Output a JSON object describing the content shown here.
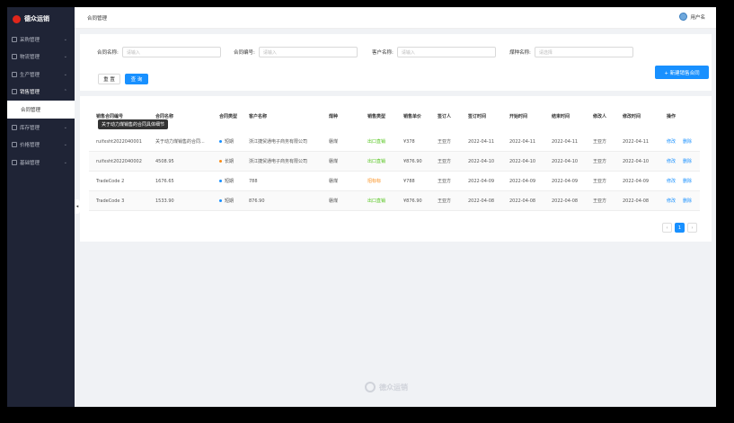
{
  "brand": {
    "name": "德众运销"
  },
  "sidebar": {
    "items": [
      {
        "label": "采购管理",
        "chev": "⌄"
      },
      {
        "label": "物流管理",
        "chev": "⌄"
      },
      {
        "label": "生产管理",
        "chev": "⌄"
      },
      {
        "label": "销售管理",
        "chev": "⌃"
      },
      {
        "label": "库存管理",
        "chev": "⌄"
      },
      {
        "label": "价格管理",
        "chev": "⌄"
      },
      {
        "label": "基础管理",
        "chev": "⌄"
      }
    ],
    "submenu_label": "合同管理"
  },
  "topbar": {
    "breadcrumb": "合同管理",
    "user": "用户名"
  },
  "filters": {
    "contract_name_label": "合同名称:",
    "contract_name_placeholder": "请输入",
    "contract_no_label": "合同编号:",
    "contract_no_placeholder": "请输入",
    "customer_label": "客户名称:",
    "customer_placeholder": "请输入",
    "coal_label": "煤种名称:",
    "coal_placeholder": "请选择",
    "reset": "重 置",
    "query": "查 询",
    "new": "+ 新建销售合同"
  },
  "table": {
    "headers": [
      "销售合同编号",
      "合同名称",
      "合同类型",
      "客户名称",
      "煤种",
      "销售类型",
      "销售单价",
      "签订人",
      "签订时间",
      "开始时间",
      "结束时间",
      "修改人",
      "修改时间",
      "操作"
    ],
    "rows": [
      {
        "code": "ruifxsht2022040001",
        "name": "关于动力煤销售的合同...",
        "type": "短期",
        "type_color": "#1890ff",
        "customer": "浙江捷贸通电子商务有限公司",
        "coal": "磐煤",
        "sale": "出口直销",
        "sale_class": "green",
        "price": "¥378",
        "signer": "王亚方",
        "sign": "2022-04-11",
        "start": "2022-04-11",
        "end": "2022-04-11",
        "modifier": "王亚方",
        "modified": "2022-04-11",
        "edit": "修改",
        "del": "删除"
      },
      {
        "code": "ruifxsht2022040002",
        "name": "4508.95",
        "type": "长期",
        "type_color": "#fa8c16",
        "customer": "浙江捷贸通电子商务有限公司",
        "coal": "磐煤",
        "sale": "出口直销",
        "sale_class": "green",
        "price": "¥876.90",
        "signer": "王亚方",
        "sign": "2022-04-10",
        "start": "2022-04-10",
        "end": "2022-04-10",
        "modifier": "王亚方",
        "modified": "2022-04-10",
        "edit": "修改",
        "del": "删除"
      },
      {
        "code": "TradeCode 2",
        "name": "1676.65",
        "type": "短期",
        "type_color": "#1890ff",
        "customer": "788",
        "coal": "磐煤",
        "sale": "招标标",
        "sale_class": "orange",
        "price": "¥788",
        "signer": "王亚方",
        "sign": "2022-04-09",
        "start": "2022-04-09",
        "end": "2022-04-09",
        "modifier": "王亚方",
        "modified": "2022-04-09",
        "edit": "修改",
        "del": "删除"
      },
      {
        "code": "TradeCode 3",
        "name": "1533.90",
        "type": "短期",
        "type_color": "#1890ff",
        "customer": "876.90",
        "coal": "磐煤",
        "sale": "出口直销",
        "sale_class": "green",
        "price": "¥876.90",
        "signer": "王亚方",
        "sign": "2022-04-08",
        "start": "2022-04-08",
        "end": "2022-04-08",
        "modifier": "王亚方",
        "modified": "2022-04-08",
        "edit": "修改",
        "del": "删除"
      }
    ],
    "tooltip": "关于动力煤销售的合同具体细节"
  },
  "pagination": {
    "prev": "‹",
    "current": "1",
    "next": "›"
  },
  "watermark": "德众运销",
  "collapse_glyph": "◂"
}
